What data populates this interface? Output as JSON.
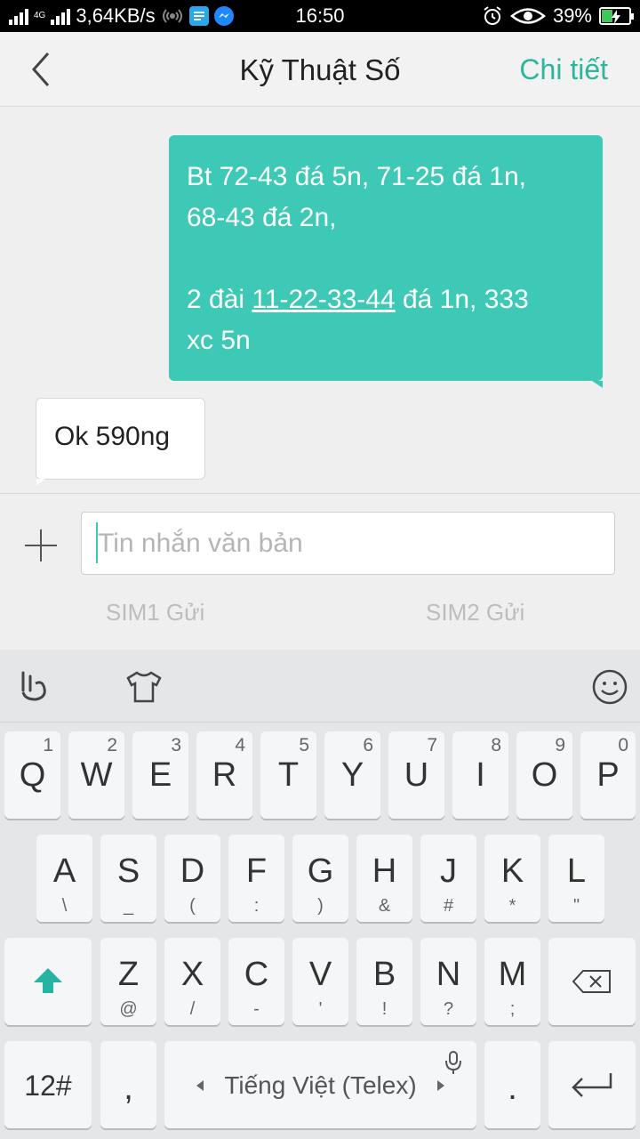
{
  "status_bar": {
    "net_type": "4G",
    "speed": "3,64KB/s",
    "time": "16:50",
    "battery": "39%",
    "battery_level": 0.39,
    "icons": [
      "signal-icon",
      "wifi-hotspot-icon",
      "message-app-icon",
      "messenger-icon",
      "alarm-icon",
      "eye-icon",
      "battery-icon"
    ]
  },
  "header": {
    "title": "Kỹ Thuật Số",
    "detail_label": "Chi tiết"
  },
  "conversation": {
    "messages": [
      {
        "direction": "outgoing",
        "line1": "Bt 72-43 đá 5n, 71-25 đá 1n,",
        "line2": "68-43 đá 2n,",
        "line3_prefix": "2 đài ",
        "line3_link": "11-22-33-44",
        "line3_suffix": " đá 1n, 333",
        "line4": "xc 5n"
      },
      {
        "direction": "incoming",
        "text": "Ok 590ng"
      }
    ]
  },
  "compose": {
    "placeholder": "Tin nhắn văn bản",
    "value": "",
    "sim1_label": "SIM1 Gửi",
    "sim2_label": "SIM2 Gửi"
  },
  "keyboard": {
    "row1": [
      {
        "main": "Q",
        "sub": "1"
      },
      {
        "main": "W",
        "sub": "2"
      },
      {
        "main": "E",
        "sub": "3"
      },
      {
        "main": "R",
        "sub": "4"
      },
      {
        "main": "T",
        "sub": "5"
      },
      {
        "main": "Y",
        "sub": "6"
      },
      {
        "main": "U",
        "sub": "7"
      },
      {
        "main": "I",
        "sub": "8"
      },
      {
        "main": "O",
        "sub": "9"
      },
      {
        "main": "P",
        "sub": "0"
      }
    ],
    "row2": [
      {
        "main": "A",
        "below": "\\"
      },
      {
        "main": "S",
        "below": "_"
      },
      {
        "main": "D",
        "below": "("
      },
      {
        "main": "F",
        "below": ":"
      },
      {
        "main": "G",
        "below": ")"
      },
      {
        "main": "H",
        "below": "&"
      },
      {
        "main": "J",
        "below": "#"
      },
      {
        "main": "K",
        "below": "*"
      },
      {
        "main": "L",
        "below": "\""
      }
    ],
    "row3": [
      {
        "main": "Z",
        "below": "@"
      },
      {
        "main": "X",
        "below": "/"
      },
      {
        "main": "C",
        "below": "-"
      },
      {
        "main": "V",
        "below": "'"
      },
      {
        "main": "B",
        "below": "!"
      },
      {
        "main": "N",
        "below": "?"
      },
      {
        "main": "M",
        "below": ";"
      }
    ],
    "numbers_label": "12#",
    "comma_label": ",",
    "space_label": "Tiếng Việt (Telex)",
    "period_label": ".",
    "accent_color": "#26b3a3"
  }
}
